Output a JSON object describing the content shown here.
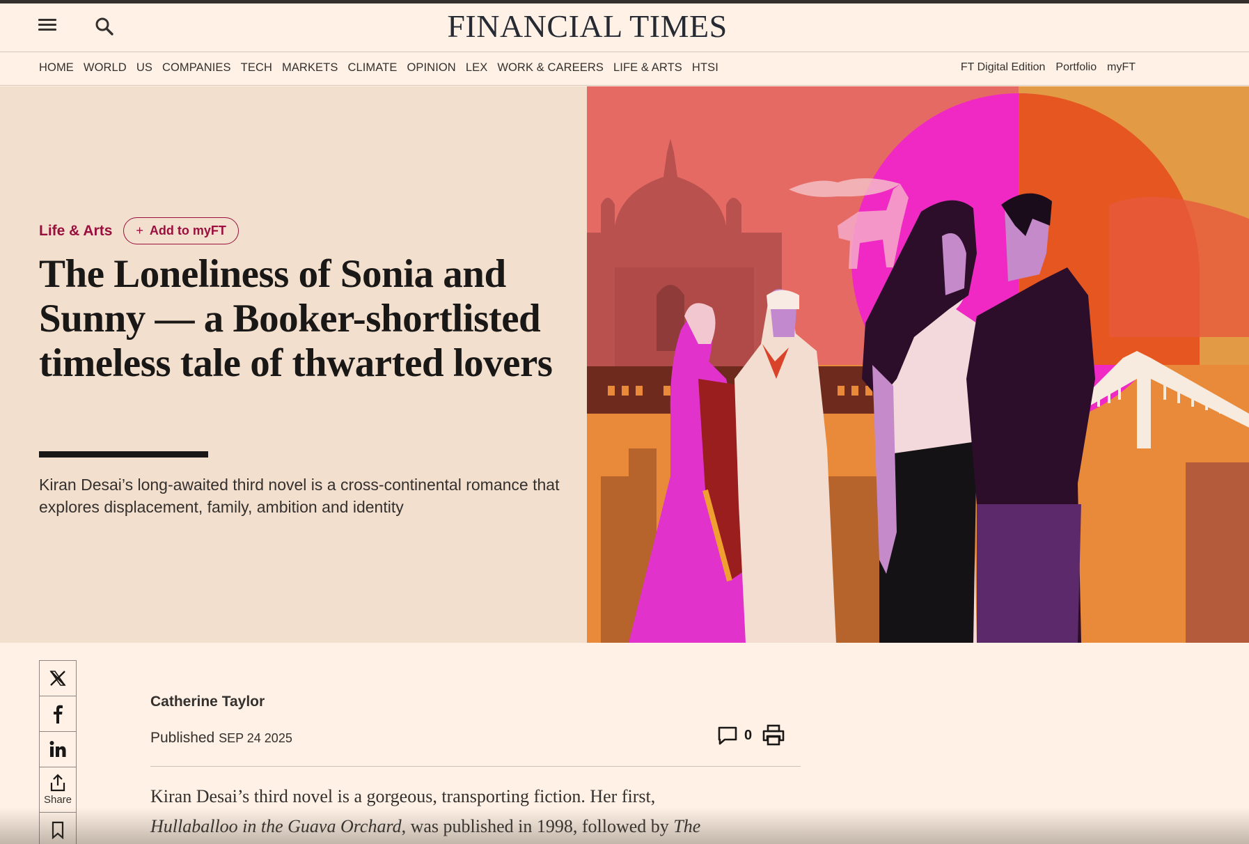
{
  "header": {
    "masthead": "FINANCIAL TIMES",
    "menu_icon": "hamburger-menu-icon",
    "search_icon": "search-icon"
  },
  "nav": {
    "links": [
      "HOME",
      "WORLD",
      "US",
      "COMPANIES",
      "TECH",
      "MARKETS",
      "CLIMATE",
      "OPINION",
      "LEX",
      "WORK & CAREERS",
      "LIFE & ARTS",
      "HTSI"
    ],
    "right_links": [
      "FT Digital Edition",
      "Portfolio",
      "myFT"
    ]
  },
  "article": {
    "section": "Life & Arts",
    "add_myft_label": "Add to myFT",
    "headline": "The Loneliness of Sonia and Sunny — a Booker-shortlisted timeless tale of thwarted lovers",
    "standfirst": "Kiran Desai’s long-awaited third novel is a cross-continental romance that explores displacement, family, ambition and identity",
    "author": "Catherine Taylor",
    "published_label": "Published",
    "published_date": "SEP 24 2025",
    "comment_count": "0",
    "body_intro": "Kiran Desai’s third novel is a gorgeous, transporting fiction. Her first,",
    "body_title_1": "Hullaballoo in the Guava Orchard",
    "body_mid": ", was published in 1998, followed by ",
    "body_title_2": "The"
  },
  "share": {
    "items": [
      "x-icon",
      "facebook-icon",
      "linkedin-icon",
      "share-icon",
      "bookmark-icon"
    ],
    "share_label": "Share"
  },
  "colors": {
    "background": "#fff1e5",
    "hero_background": "#f2dfce",
    "claret": "#990f3d",
    "text": "#33302e"
  }
}
